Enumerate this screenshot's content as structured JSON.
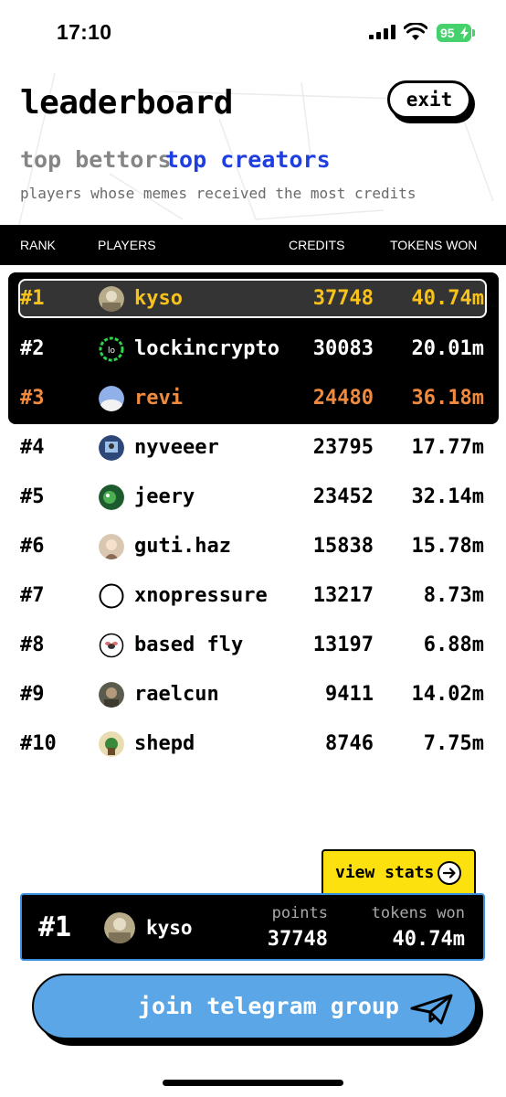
{
  "status_bar": {
    "time": "17:10",
    "battery": "95"
  },
  "header": {
    "title": "leaderboard",
    "exit_label": "exit"
  },
  "tabs": [
    {
      "label": "top bettors",
      "active": false
    },
    {
      "label": "top creators",
      "active": true
    }
  ],
  "subtitle": "players whose memes received the most credits",
  "table": {
    "columns": [
      "RANK",
      "PLAYERS",
      "CREDITS",
      "TOKENS WON"
    ],
    "rows": [
      {
        "rank": "#1",
        "player": "kyso",
        "credits": "37748",
        "tokens": "40.74m"
      },
      {
        "rank": "#2",
        "player": "lockincrypto",
        "credits": "30083",
        "tokens": "20.01m"
      },
      {
        "rank": "#3",
        "player": "revi",
        "credits": "24480",
        "tokens": "36.18m"
      },
      {
        "rank": "#4",
        "player": "nyveeer",
        "credits": "23795",
        "tokens": "17.77m"
      },
      {
        "rank": "#5",
        "player": "jeery",
        "credits": "23452",
        "tokens": "32.14m"
      },
      {
        "rank": "#6",
        "player": "guti.haz",
        "credits": "15838",
        "tokens": "15.78m"
      },
      {
        "rank": "#7",
        "player": "xnopressure",
        "credits": "13217",
        "tokens": "8.73m"
      },
      {
        "rank": "#8",
        "player": "based fly",
        "credits": "13197",
        "tokens": "6.88m"
      },
      {
        "rank": "#9",
        "player": "raelcun",
        "credits": "9411",
        "tokens": "14.02m"
      },
      {
        "rank": "#10",
        "player": "shepd",
        "credits": "8746",
        "tokens": "7.75m"
      }
    ]
  },
  "view_stats_label": "view stats",
  "my_rank": {
    "rank": "#1",
    "player": "kyso",
    "points_label": "points",
    "points": "37748",
    "tokens_label": "tokens won",
    "tokens": "40.74m"
  },
  "telegram_label": "join telegram group",
  "colors": {
    "gold": "#f7c21c",
    "bronze": "#f08a3e",
    "active_tab": "#1f3ee0",
    "inactive_tab": "#858585",
    "telegram_blue": "#5aa6e6",
    "view_stats_yellow": "#fde10f",
    "card_border": "#3b8fe0"
  }
}
